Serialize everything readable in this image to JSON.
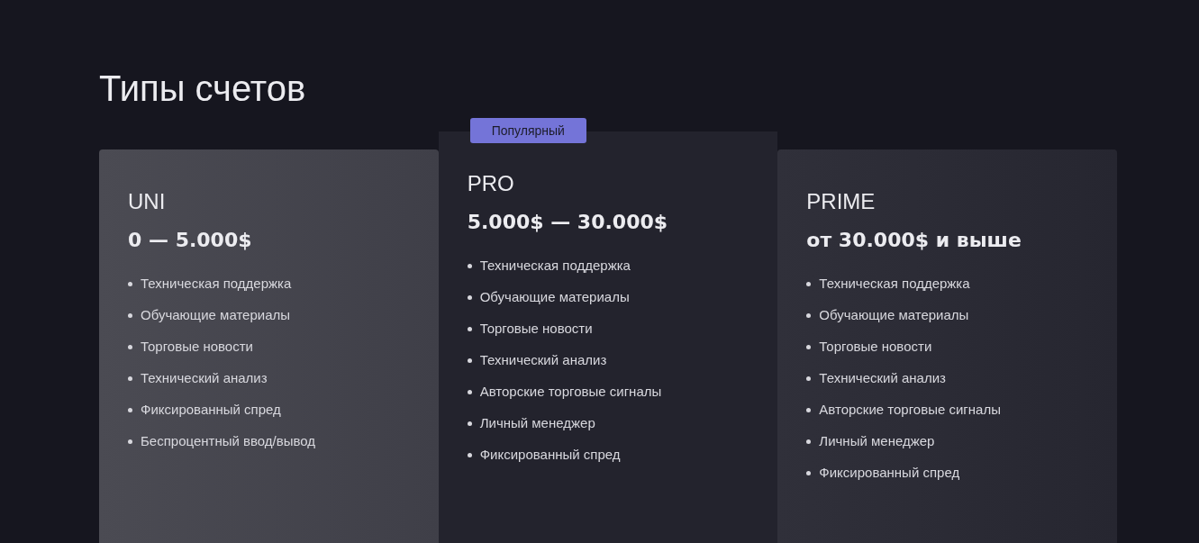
{
  "title": "Типы счетов",
  "plans": [
    {
      "kind": "light",
      "name": "UNI",
      "price": "0 — 5.000$",
      "features": [
        "Техническая поддержка",
        "Обучающие материалы",
        "Торговые новости",
        "Технический анализ",
        "Фиксированный спред",
        "Беспроцентный ввод/вывод"
      ]
    },
    {
      "kind": "featured",
      "badge": "Популярный",
      "name": "PRO",
      "price": "5.000$ — 30.000$",
      "features": [
        "Техническая поддержка",
        "Обучающие материалы",
        "Торговые новости",
        "Технический анализ",
        "Авторские торговые сигналы",
        "Личный менеджер",
        "Фиксированный спред"
      ]
    },
    {
      "kind": "dark",
      "name": "PRIME",
      "price": "от 30.000$ и выше",
      "features": [
        "Техническая поддержка",
        "Обучающие материалы",
        "Торговые новости",
        "Технический анализ",
        "Авторские торговые сигналы",
        "Личный менеджер",
        "Фиксированный спред"
      ]
    }
  ]
}
